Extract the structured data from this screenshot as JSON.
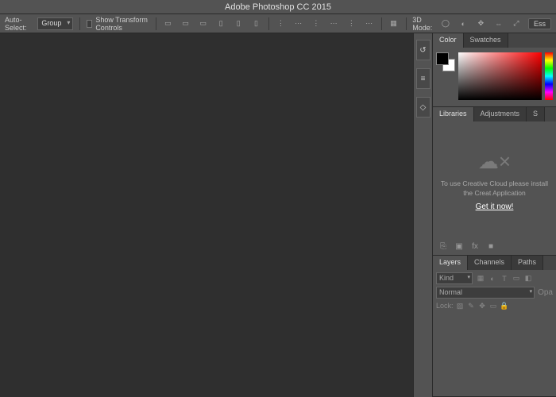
{
  "title": "Adobe Photoshop CC 2015",
  "options": {
    "auto_select_label": "Auto-Select:",
    "auto_select_dropdown": "Group",
    "transform_controls_label": "Show Transform Controls",
    "mode_3d_label": "3D Mode:",
    "workspace": "Ess"
  },
  "panels": {
    "color": {
      "tabs": [
        "Color",
        "Swatches"
      ],
      "active": 0
    },
    "libraries": {
      "tabs": [
        "Libraries",
        "Adjustments",
        "S"
      ],
      "active": 0,
      "message": "To use Creative Cloud please install the Creat Application",
      "cta": "Get it now!"
    },
    "layers": {
      "tabs": [
        "Layers",
        "Channels",
        "Paths"
      ],
      "active": 0,
      "filter_label": "Kind",
      "blend_label": "Normal",
      "opacity_label": "Opa",
      "lock_label": "Lock:"
    }
  }
}
